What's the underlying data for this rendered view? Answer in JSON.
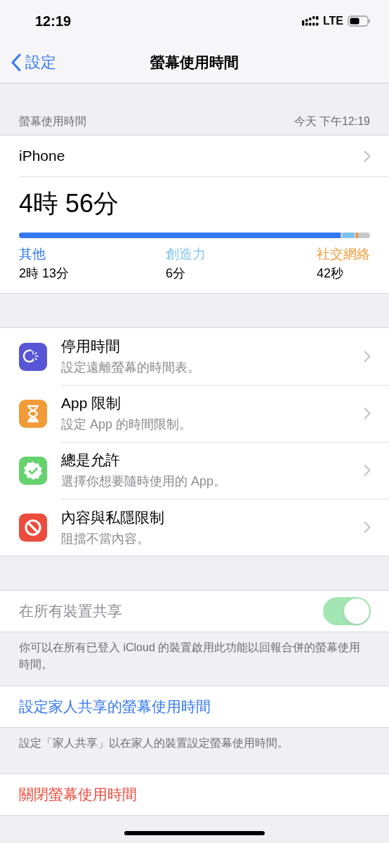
{
  "status_bar": {
    "time": "12:19",
    "network": "LTE"
  },
  "nav": {
    "back": "設定",
    "title": "螢幕使用時間"
  },
  "summary": {
    "header": "螢幕使用時間",
    "date": "今天 下午12:19",
    "device": "iPhone",
    "total": "4時 56分",
    "categories": [
      {
        "name": "其他",
        "time": "2時 13分",
        "color": "#3478f6"
      },
      {
        "name": "創造力",
        "time": "6分",
        "color": "#7cc3ec"
      },
      {
        "name": "社交網絡",
        "time": "42秒",
        "color": "#f09a37"
      }
    ]
  },
  "features": [
    {
      "kind": "downtime",
      "title": "停用時間",
      "subtitle": "設定遠離螢幕的時間表。",
      "color": "#5856d6"
    },
    {
      "kind": "limits",
      "title": "App 限制",
      "subtitle": "設定 App 的時間限制。",
      "color": "#f19a37"
    },
    {
      "kind": "allowed",
      "title": "總是允許",
      "subtitle": "選擇你想要隨時使用的 App。",
      "color": "#65d26e"
    },
    {
      "kind": "restrictions",
      "title": "內容與私隱限制",
      "subtitle": "阻擋不當內容。",
      "color": "#eb4d3d"
    }
  ],
  "share": {
    "label": "在所有裝置共享",
    "on": true,
    "disabled": true,
    "footer": "你可以在所有已登入 iCloud 的裝置啟用此功能以回報合併的螢幕使用時間。"
  },
  "family": {
    "link": "設定家人共享的螢幕使用時間",
    "footer": "設定「家人共享」以在家人的裝置設定螢幕使用時間。"
  },
  "turn_off": {
    "label": "關閉螢幕使用時間"
  }
}
